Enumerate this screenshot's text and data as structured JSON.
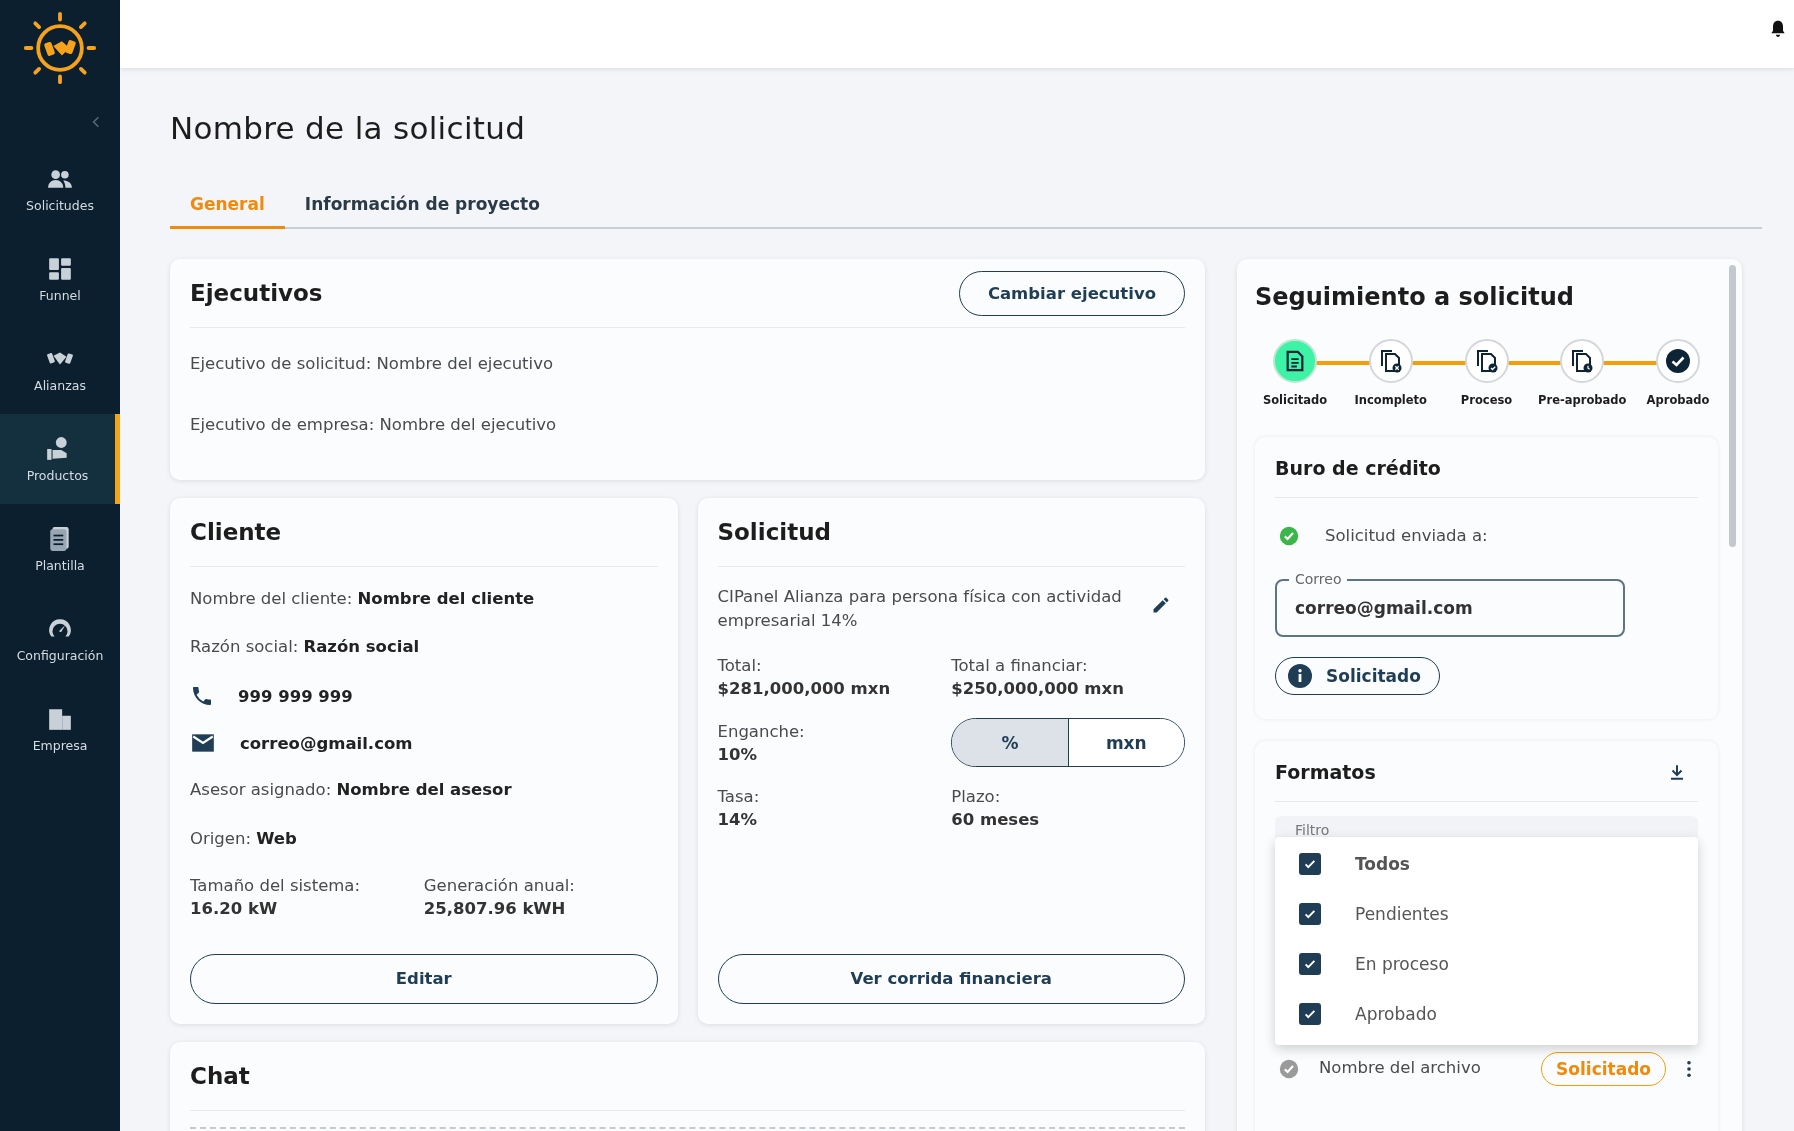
{
  "sidebar": {
    "items": [
      {
        "label": "Solicitudes",
        "selected": false
      },
      {
        "label": "Funnel",
        "selected": false
      },
      {
        "label": "Alianzas",
        "selected": false
      },
      {
        "label": "Productos",
        "selected": true
      },
      {
        "label": "Plantilla",
        "selected": false
      },
      {
        "label": "Configuración",
        "selected": false
      },
      {
        "label": "Empresa",
        "selected": false
      }
    ]
  },
  "page_title": "Nombre de la solicitud",
  "tabs": [
    {
      "label": "General",
      "selected": true
    },
    {
      "label": "Información de proyecto",
      "selected": false
    }
  ],
  "ejecutivos": {
    "title": "Ejecutivos",
    "button": "Cambiar ejecutivo",
    "lines": [
      "Ejecutivo de solicitud: Nombre del ejecutivo",
      "Ejecutivo de empresa: Nombre del ejecutivo"
    ]
  },
  "cliente": {
    "title": "Cliente",
    "rows": [
      {
        "kind": "text",
        "text": "Nombre del cliente: **Nombre del cliente**"
      },
      {
        "kind": "text",
        "text": "Razón social: **Razón social**"
      },
      {
        "kind": "phone",
        "text": "999 999 999"
      },
      {
        "kind": "email",
        "text": "correo@gmail.com"
      },
      {
        "kind": "text",
        "text": "Asesor asignado: **Nombre del asesor**"
      },
      {
        "kind": "text",
        "text": "Origen: **Web**"
      },
      {
        "kind": "pair",
        "items": [
          {
            "label": "Tamaño del sistema:",
            "value": "16.20 kW"
          },
          {
            "label": "Generación anual:",
            "value": "25,807.96 kWH"
          }
        ]
      }
    ],
    "button": "Editar"
  },
  "solicitud": {
    "title": "Solicitud",
    "description": "CIPanel Alianza para persona física con actividad empresarial 14%",
    "rows": [
      {
        "kind": "pair",
        "items": [
          {
            "label": "Total:",
            "value": "$281,000,000 mxn"
          },
          {
            "label": "Total a financiar:",
            "value": "$250,000,000 mxn"
          }
        ]
      },
      {
        "kind": "toggle",
        "label": "Enganche:",
        "value": "10%",
        "options": [
          {
            "label": "%",
            "selected": true
          },
          {
            "label": "mxn",
            "selected": false
          }
        ]
      },
      {
        "kind": "pair",
        "items": [
          {
            "label": "Tasa:",
            "value": "14%"
          },
          {
            "label": "Plazo:",
            "value": "60 meses"
          }
        ]
      }
    ],
    "button": "Ver corrida financiera"
  },
  "chat": {
    "title": "Chat"
  },
  "seguimiento": {
    "title": "Seguimiento a solicitud",
    "steps": [
      {
        "label": "Solicitado",
        "kind": "doc",
        "selected": true
      },
      {
        "label": "Incompleto",
        "kind": "doc-x",
        "selected": false
      },
      {
        "label": "Proceso",
        "kind": "doc-check",
        "selected": false
      },
      {
        "label": "Pre-aprobado",
        "kind": "doc-clock",
        "selected": false
      },
      {
        "label": "Aprobado",
        "kind": "check",
        "selected": false
      }
    ]
  },
  "buro": {
    "title": "Buro de crédito",
    "status": "Solicitud enviada a:",
    "field_label": "Correo",
    "field_value": "correo@gmail.com",
    "chip": "Solicitado"
  },
  "formatos": {
    "title": "Formatos",
    "filter_label": "Filtro",
    "filter_options": [
      {
        "label": "Todos",
        "checked": true
      },
      {
        "label": "Pendientes",
        "checked": true
      },
      {
        "label": "En proceso",
        "checked": true
      },
      {
        "label": "Aprobado",
        "checked": true
      }
    ],
    "files": [
      {
        "name": "Nombre del archivo",
        "status": "Solicitado"
      }
    ]
  }
}
